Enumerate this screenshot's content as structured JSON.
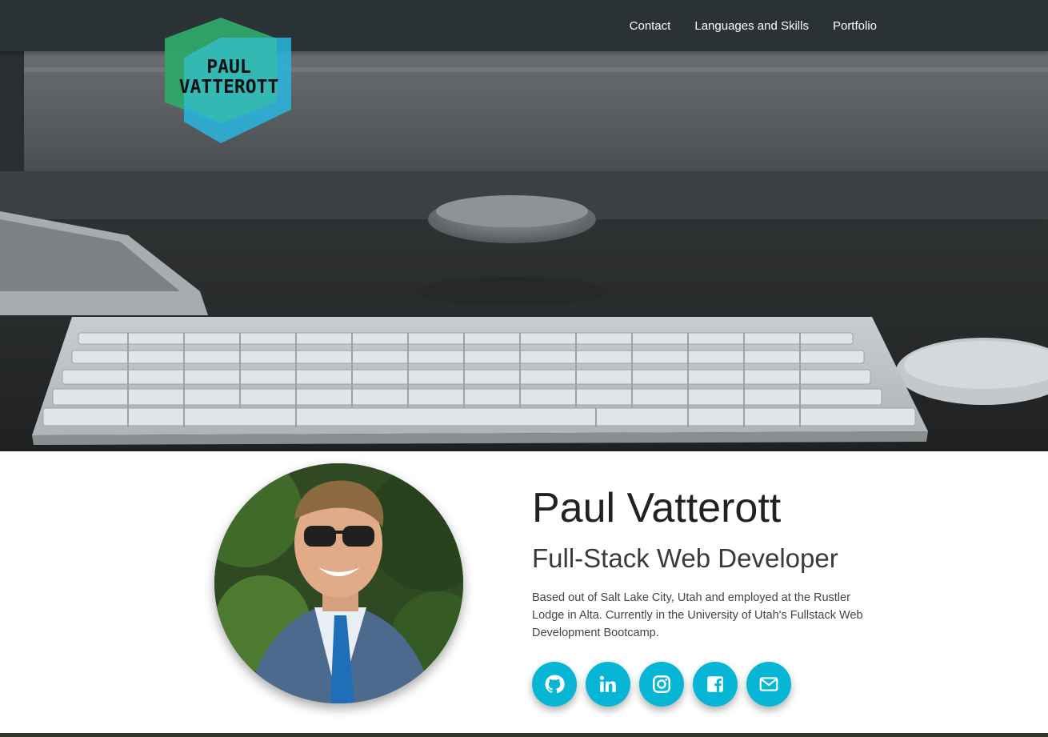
{
  "nav": {
    "links": [
      {
        "label": "Contact"
      },
      {
        "label": "Languages and Skills"
      },
      {
        "label": "Portfolio"
      }
    ]
  },
  "logo": {
    "line1": "PAUL",
    "line2": "VATTEROTT",
    "colors": {
      "green": "#2fa86a",
      "blue": "#29b6e0",
      "teal": "#34b8b0"
    }
  },
  "profile": {
    "name": "Paul Vatterott",
    "title": "Full-Stack Web Developer",
    "bio": "Based out of Salt Lake City, Utah and employed at the Rustler Lodge in Alta. Currently in the University of Utah's Fullstack Web Development Bootcamp."
  },
  "socials": [
    {
      "icon": "github-icon"
    },
    {
      "icon": "linkedin-icon"
    },
    {
      "icon": "instagram-icon"
    },
    {
      "icon": "facebook-icon"
    },
    {
      "icon": "mail-icon"
    }
  ],
  "accent": "#06b6d4"
}
